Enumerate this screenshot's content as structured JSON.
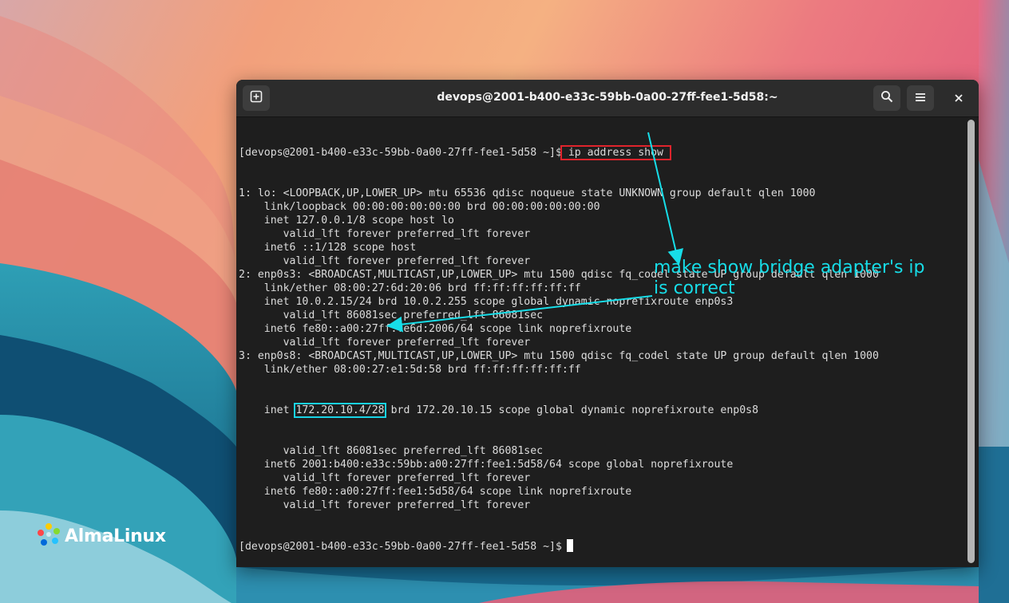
{
  "window": {
    "title": "devops@2001-b400-e33c-59bb-0a00-27ff-fee1-5d58:~"
  },
  "brand": {
    "name": "AlmaLinux"
  },
  "terminal": {
    "prompt": "[devops@2001-b400-e33c-59bb-0a00-27ff-fee1-5d58 ~]$",
    "command": " ip address show ",
    "lines": [
      "1: lo: <LOOPBACK,UP,LOWER_UP> mtu 65536 qdisc noqueue state UNKNOWN group default qlen 1000",
      "    link/loopback 00:00:00:00:00:00 brd 00:00:00:00:00:00",
      "    inet 127.0.0.1/8 scope host lo",
      "       valid_lft forever preferred_lft forever",
      "    inet6 ::1/128 scope host",
      "       valid_lft forever preferred_lft forever",
      "2: enp0s3: <BROADCAST,MULTICAST,UP,LOWER_UP> mtu 1500 qdisc fq_codel state UP group default qlen 1000",
      "    link/ether 08:00:27:6d:20:06 brd ff:ff:ff:ff:ff:ff",
      "    inet 10.0.2.15/24 brd 10.0.2.255 scope global dynamic noprefixroute enp0s3",
      "       valid_lft 86081sec preferred_lft 86081sec",
      "    inet6 fe80::a00:27ff:fe6d:2006/64 scope link noprefixroute",
      "       valid_lft forever preferred_lft forever",
      "3: enp0s8: <BROADCAST,MULTICAST,UP,LOWER_UP> mtu 1500 qdisc fq_codel state UP group default qlen 1000",
      "    link/ether 08:00:27:e1:5d:58 brd ff:ff:ff:ff:ff:ff"
    ],
    "inet_line": {
      "prefix": "    inet ",
      "address": "172.20.10.4/28",
      "suffix": " brd 172.20.10.15 scope global dynamic noprefixroute enp0s8"
    },
    "lines_after": [
      "       valid_lft 86081sec preferred_lft 86081sec",
      "    inet6 2001:b400:e33c:59bb:a00:27ff:fee1:5d58/64 scope global noprefixroute",
      "       valid_lft forever preferred_lft forever",
      "    inet6 fe80::a00:27ff:fee1:5d58/64 scope link noprefixroute",
      "       valid_lft forever preferred_lft forever"
    ]
  },
  "annotation": {
    "text": "make show bridge adapter's ip\nis correct",
    "color": "#17dde8"
  },
  "colors": {
    "highlight_red": "#e0242c",
    "highlight_cyan": "#19d3e6"
  },
  "icons": [
    "new-tab-icon",
    "search-icon",
    "hamburger-menu-icon",
    "close-icon",
    "almalinux-logo-icon"
  ]
}
